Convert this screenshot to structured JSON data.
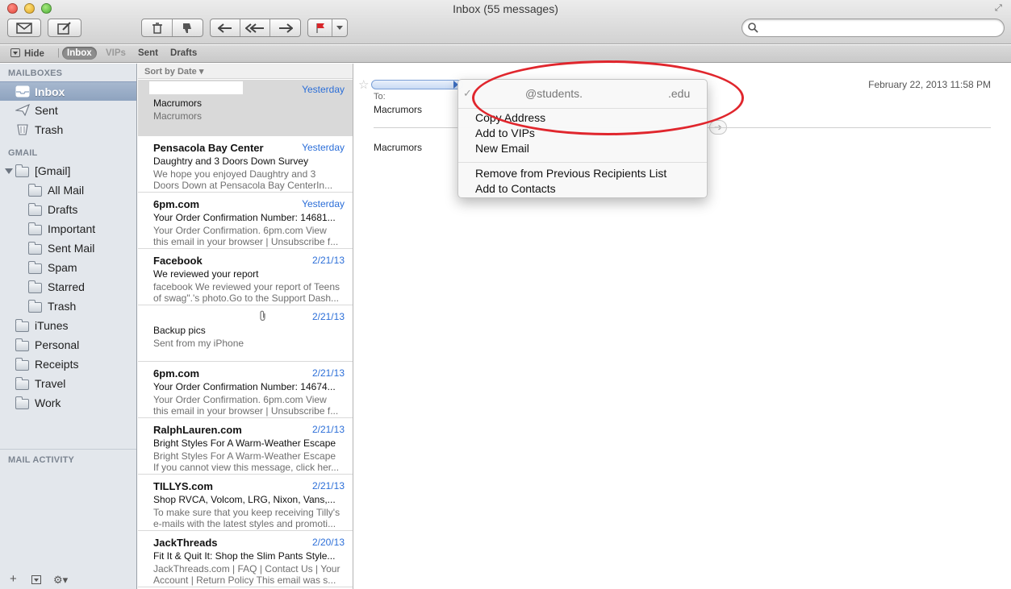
{
  "window": {
    "title": "Inbox (55 messages)"
  },
  "search": {
    "placeholder": ""
  },
  "favorites": {
    "hide": "Hide",
    "inbox": "Inbox",
    "vips": "VIPs",
    "sent": "Sent",
    "drafts": "Drafts"
  },
  "sidebar": {
    "mailboxes_header": "MAILBOXES",
    "mailboxes": [
      {
        "label": "Inbox",
        "icon": "inbox-icon"
      },
      {
        "label": "Sent",
        "icon": "paper-plane-icon"
      },
      {
        "label": "Trash",
        "icon": "trash-icon"
      }
    ],
    "gmail_header": "GMAIL",
    "gmail_root": "[Gmail]",
    "gmail_children": [
      "All Mail",
      "Drafts",
      "Important",
      "Sent Mail",
      "Spam",
      "Starred",
      "Trash"
    ],
    "other_folders": [
      "iTunes",
      "Personal",
      "Receipts",
      "Travel",
      "Work"
    ],
    "activity_header": "MAIL ACTIVITY",
    "bottom": {
      "add": "+",
      "gear": "⚙▾"
    }
  },
  "list": {
    "sort_label": "Sort by Date ▾",
    "messages": [
      {
        "from": "",
        "date": "Yesterday",
        "subject": "Macrumors",
        "preview": "Macrumors"
      },
      {
        "from": "Pensacola Bay Center",
        "date": "Yesterday",
        "subject": "Daughtry and 3 Doors Down Survey",
        "preview": "We hope you enjoyed Daughtry and 3 Doors Down at Pensacola Bay CenterIn..."
      },
      {
        "from": "6pm.com",
        "date": "Yesterday",
        "subject": "Your Order Confirmation Number: 14681...",
        "preview": "Your Order Confirmation. 6pm.com View this email in your browser | Unsubscribe f..."
      },
      {
        "from": "Facebook",
        "date": "2/21/13",
        "subject": "We reviewed your report",
        "preview": "facebook We reviewed your report of Teens of swag\".'s photo.Go to the Support Dash..."
      },
      {
        "from": "",
        "date": "2/21/13",
        "subject": "Backup pics",
        "preview": "Sent from my iPhone"
      },
      {
        "from": "6pm.com",
        "date": "2/21/13",
        "subject": "Your Order Confirmation Number: 14674...",
        "preview": "Your Order Confirmation. 6pm.com View this email in your browser | Unsubscribe f..."
      },
      {
        "from": "RalphLauren.com",
        "date": "2/21/13",
        "subject": "Bright Styles For A Warm-Weather Escape",
        "preview": "Bright Styles For A Warm-Weather Escape If you cannot view this message, click her..."
      },
      {
        "from": "TILLYS.com",
        "date": "2/21/13",
        "subject": "Shop RVCA, Volcom, LRG, Nixon, Vans,...",
        "preview": "To make sure that you keep receiving Tilly's e-mails with the latest styles and promoti..."
      },
      {
        "from": "JackThreads",
        "date": "2/20/13",
        "subject": "Fit It & Quit It: Shop the Slim Pants Style...",
        "preview": "JackThreads.com | FAQ | Contact Us | Your Account | Return Policy This email was s..."
      }
    ]
  },
  "reader": {
    "date": "February 22, 2013   11:58 PM",
    "to_label": "To:",
    "subject": "Macrumors",
    "body": "Macrumors"
  },
  "context_menu": {
    "check": "✓",
    "address_domain": "@students.",
    "address_tld": ".edu",
    "items": [
      "Copy Address",
      "Add to VIPs",
      "New Email",
      "Remove from Previous Recipients List",
      "Add to Contacts"
    ]
  },
  "colors": {
    "accent_date": "#2b6ed8",
    "annotation": "#e0262d",
    "sidebar_bg": "#e3e7ec"
  }
}
